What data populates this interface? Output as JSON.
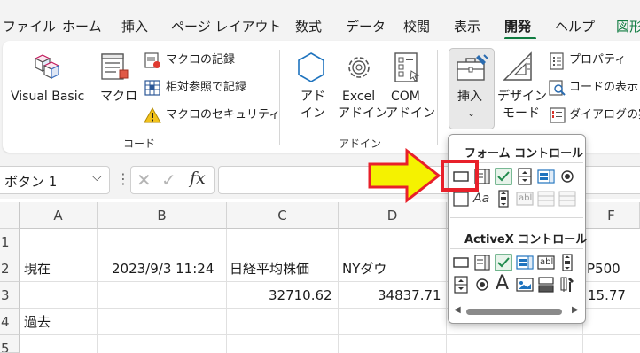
{
  "menu": {
    "tabs": [
      "ファイル",
      "ホーム",
      "挿入",
      "ページ レイアウト",
      "数式",
      "データ",
      "校閲",
      "表示",
      "開発",
      "ヘルプ",
      "図形"
    ],
    "active_tab": "開発"
  },
  "ribbon": {
    "code_group": {
      "visual_basic": "Visual Basic",
      "macro": "マクロ",
      "record_macro": "マクロの記録",
      "relative_ref": "相対参照で記録",
      "macro_security": "マクロのセキュリティ",
      "label": "コード"
    },
    "addins_group": {
      "addin_line1": "アド",
      "addin_line2": "イン",
      "excel_addin_line1": "Excel",
      "excel_addin_line2": "アドイン",
      "com_addin_line1": "COM",
      "com_addin_line2": "アドイン",
      "label": "アドイン"
    },
    "controls_group": {
      "insert": "挿入",
      "design_mode_line1": "デザイン",
      "design_mode_line2": "モード",
      "properties": "プロパティ",
      "view_code": "コードの表示",
      "run_dialog": "ダイアログの実"
    }
  },
  "formula_bar": {
    "name_box": "ボタン 1",
    "fx": "fx"
  },
  "grid": {
    "columns": [
      "A",
      "B",
      "C",
      "D",
      "F"
    ],
    "rows": [
      "1",
      "2",
      "3",
      "4",
      "5"
    ],
    "cells": {
      "A2": "現在",
      "B2": "2023/9/3 11:24",
      "C2": "日経平均株価",
      "D2": "NYダウ",
      "F2": "P500",
      "C3": "32710.62",
      "D3": "34837.71",
      "F3": "15.77",
      "A4": "過去"
    }
  },
  "dropdown": {
    "form_controls_title": "フォーム コントロール",
    "activex_title": "ActiveX コントロール",
    "aa_label": "Aa",
    "abl_label": "abl",
    "big_a": "A"
  },
  "colors": {
    "accent_green": "#107c41",
    "highlight_red": "#e8202a",
    "arrow_yellow": "#f5f200"
  }
}
